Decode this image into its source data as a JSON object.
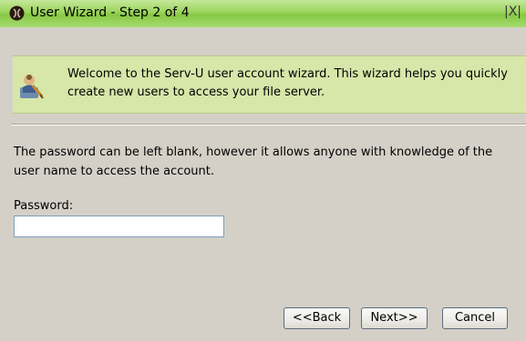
{
  "window": {
    "title": "User Wizard - Step 2 of 4",
    "close_glyph": "|X|"
  },
  "banner": {
    "text": "Welcome to the Serv-U user account wizard. This wizard helps you quickly create new users to access your file server.",
    "icon": "user-wizard-icon"
  },
  "form": {
    "instructions": "The password can be left blank, however it allows anyone with knowledge of the user name to access the account.",
    "password_label": "Password:",
    "password_value": ""
  },
  "buttons": {
    "back": "<<Back",
    "next": "Next>>",
    "cancel": "Cancel"
  },
  "colors": {
    "titlebar": "#9bd45c",
    "banner": "#d7e6a9",
    "background": "#d4d0c8"
  }
}
